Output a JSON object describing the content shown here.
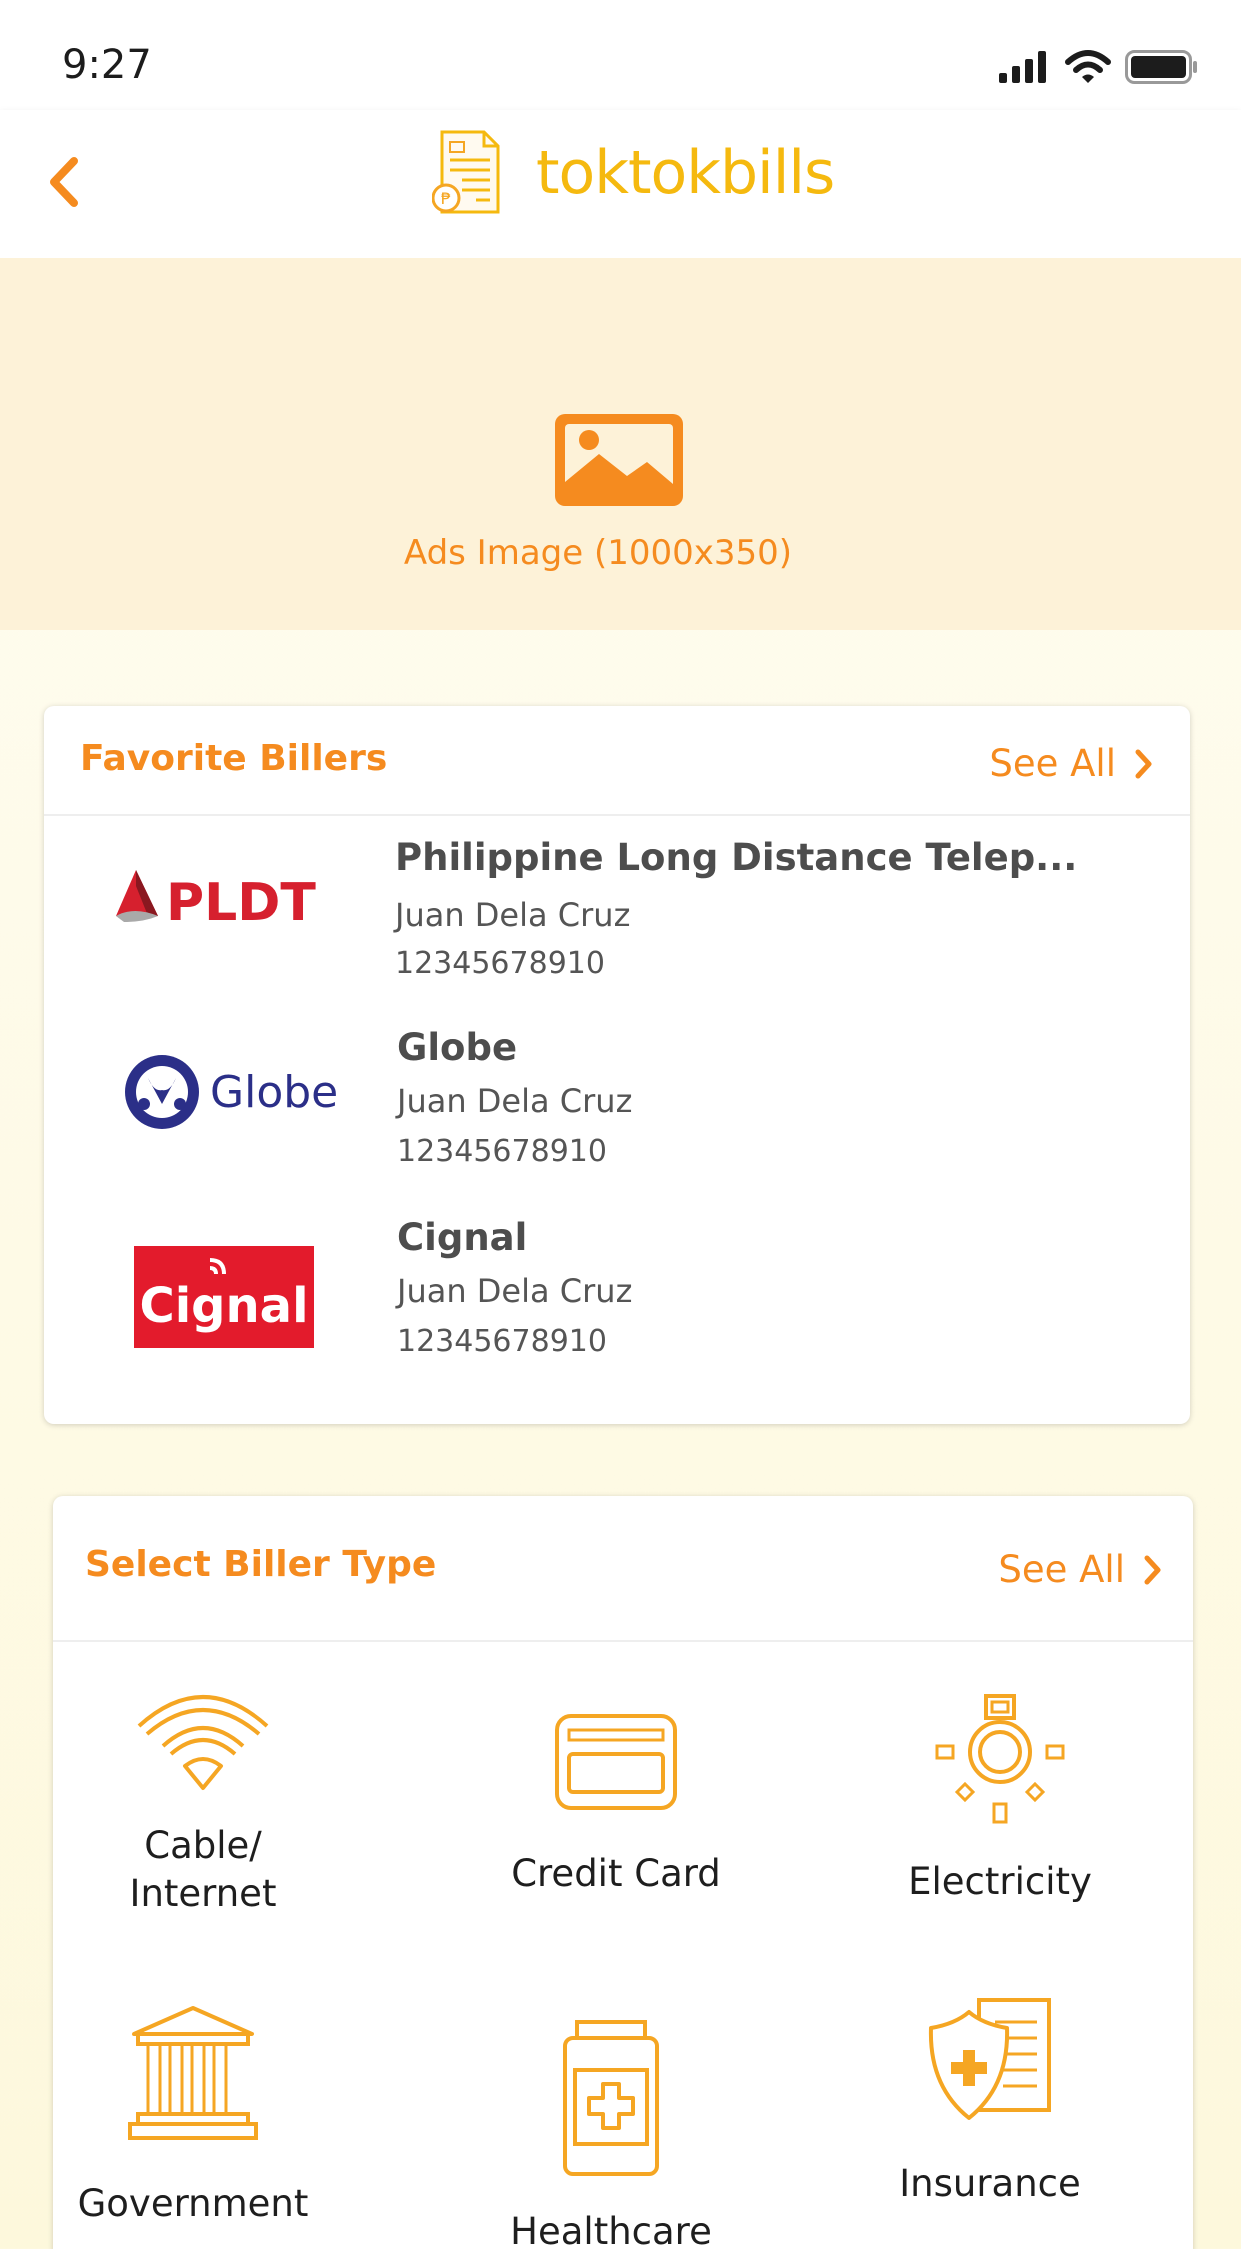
{
  "status_bar": {
    "time": "9:27"
  },
  "header": {
    "brand_name": "toktokbills"
  },
  "ads": {
    "label": "Ads Image (1000x350)"
  },
  "favorite_billers": {
    "title": "Favorite Billers",
    "see_all": "See All",
    "items": [
      {
        "logo": "PLDT",
        "name": "Philippine Long Distance Telep...",
        "account_name": "Juan Dela Cruz",
        "account_number": "12345678910"
      },
      {
        "logo": "Globe",
        "name": "Globe",
        "account_name": "Juan Dela Cruz",
        "account_number": "12345678910"
      },
      {
        "logo": "Cignal",
        "name": "Cignal",
        "account_name": "Juan Dela Cruz",
        "account_number": "12345678910"
      }
    ]
  },
  "biller_types": {
    "title": "Select Biller Type",
    "see_all": "See All",
    "items": [
      {
        "label_line1": "Cable/",
        "label_line2": "Internet",
        "icon": "wifi-icon"
      },
      {
        "label": "Credit Card",
        "icon": "credit-card-icon"
      },
      {
        "label": "Electricity",
        "icon": "light-bulb-icon"
      },
      {
        "label": "Government",
        "icon": "government-building-icon"
      },
      {
        "label": "Healthcare",
        "icon": "medicine-bottle-icon"
      },
      {
        "label": "Insurance",
        "icon": "insurance-shield-icon"
      }
    ]
  },
  "colors": {
    "accent": "#f58b1f",
    "brand_yellow": "#f5b90f",
    "banner_bg": "#fdf2d8",
    "icon_yellow": "#f5a623"
  }
}
